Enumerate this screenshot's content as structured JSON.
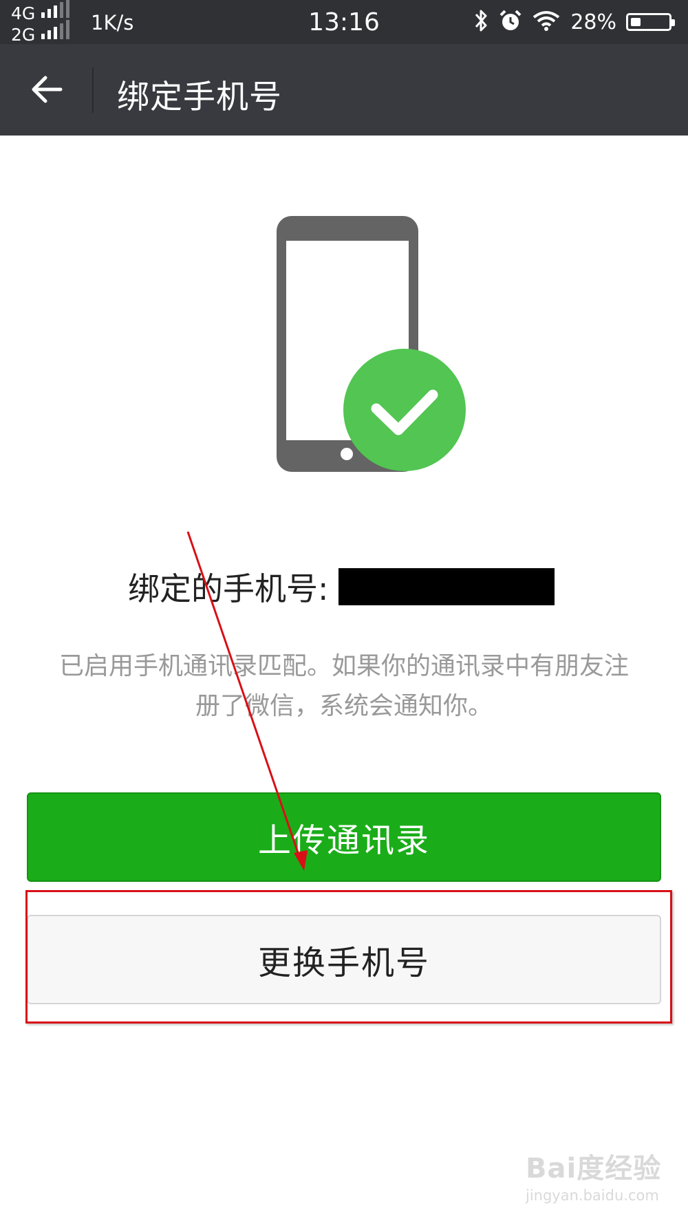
{
  "status_bar": {
    "net_4g": "4G",
    "net_2g": "2G",
    "speed": "1K/s",
    "time": "13:16",
    "battery": "28%",
    "icons": [
      "bluetooth-icon",
      "alarm-icon",
      "wifi-icon",
      "battery-icon"
    ]
  },
  "nav": {
    "title": "绑定手机号",
    "back_icon": "arrow-left-icon"
  },
  "hero": {
    "icons": [
      "phone-icon",
      "check-circle-icon"
    ],
    "check_color": "#52c552"
  },
  "bound": {
    "label": "绑定的手机号:"
  },
  "description": {
    "line1": "已启用手机通讯录匹配。如果你的通讯录中有朋友注",
    "line2": "册了微信，系统会通知你。"
  },
  "buttons": {
    "upload_label": "上传通讯录",
    "change_label": "更换手机号"
  },
  "annotation": {
    "color": "#d90f17"
  },
  "watermark": {
    "main": "Bai度经验",
    "sub": "jingyan.baidu.com"
  }
}
